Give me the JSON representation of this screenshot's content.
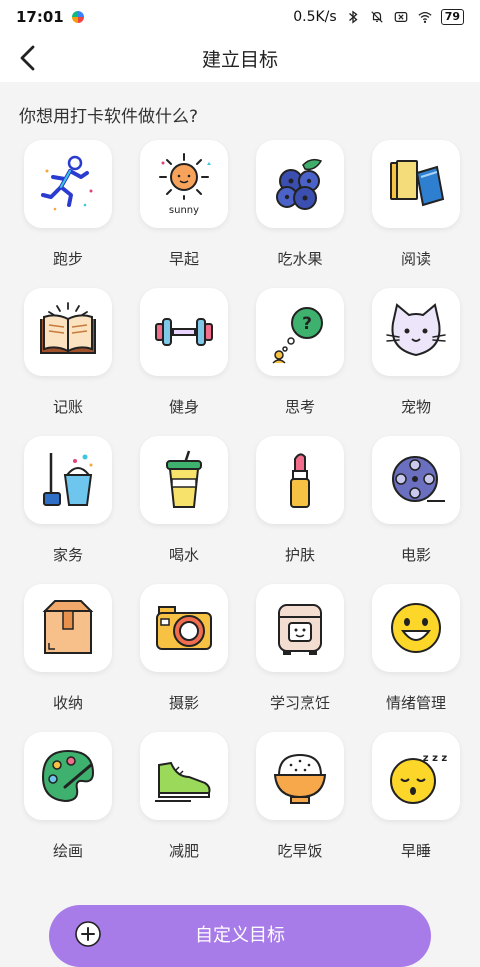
{
  "status_bar": {
    "time": "17:01",
    "net_speed": "0.5K/s",
    "battery": "79"
  },
  "header": {
    "title": "建立目标"
  },
  "question": "你想用打卡软件做什么?",
  "goals": [
    {
      "label": "跑步",
      "icon": "running-person-icon"
    },
    {
      "label": "早起",
      "icon": "sunny-sun-icon",
      "icon_text": "sunny"
    },
    {
      "label": "吃水果",
      "icon": "blueberries-icon"
    },
    {
      "label": "阅读",
      "icon": "books-icon"
    },
    {
      "label": "记账",
      "icon": "open-ledger-icon"
    },
    {
      "label": "健身",
      "icon": "dumbbell-icon"
    },
    {
      "label": "思考",
      "icon": "question-bubble-icon"
    },
    {
      "label": "宠物",
      "icon": "cat-face-icon"
    },
    {
      "label": "家务",
      "icon": "mop-bucket-icon"
    },
    {
      "label": "喝水",
      "icon": "drink-cup-icon"
    },
    {
      "label": "护肤",
      "icon": "lipstick-icon"
    },
    {
      "label": "电影",
      "icon": "film-reel-icon"
    },
    {
      "label": "收纳",
      "icon": "storage-box-icon"
    },
    {
      "label": "摄影",
      "icon": "camera-icon"
    },
    {
      "label": "学习烹饪",
      "icon": "rice-cooker-icon"
    },
    {
      "label": "情绪管理",
      "icon": "smiley-face-icon"
    },
    {
      "label": "绘画",
      "icon": "paint-palette-icon"
    },
    {
      "label": "减肥",
      "icon": "sneaker-icon"
    },
    {
      "label": "吃早饭",
      "icon": "rice-bowl-icon"
    },
    {
      "label": "早睡",
      "icon": "sleepy-face-icon",
      "icon_text": "z z z"
    }
  ],
  "custom_button": {
    "label": "自定义目标",
    "icon": "plus-circle-icon",
    "color": "#a77be8"
  }
}
